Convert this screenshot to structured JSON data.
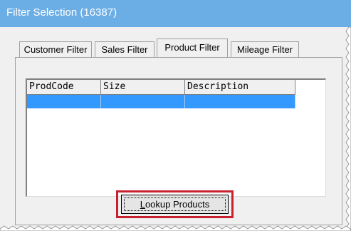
{
  "window": {
    "title": "Filter Selection (16387)"
  },
  "tabs": [
    {
      "label": "Customer Filter",
      "active": false
    },
    {
      "label": "Sales Filter",
      "active": false
    },
    {
      "label": "Product Filter",
      "active": true
    },
    {
      "label": "Mileage Filter",
      "active": false
    }
  ],
  "grid": {
    "columns": [
      "ProdCode",
      "Size",
      "Description"
    ],
    "rows": [
      {
        "selected": true,
        "cells": [
          "",
          "",
          ""
        ]
      }
    ]
  },
  "lookup_button": {
    "label_prefix": "",
    "label_mnemonic": "L",
    "label_rest": "ookup Products"
  },
  "colors": {
    "title_bar": "#6baee6",
    "selection": "#3399ff",
    "highlight_outline": "#c8202e",
    "window_bg": "#f0f0f0"
  }
}
